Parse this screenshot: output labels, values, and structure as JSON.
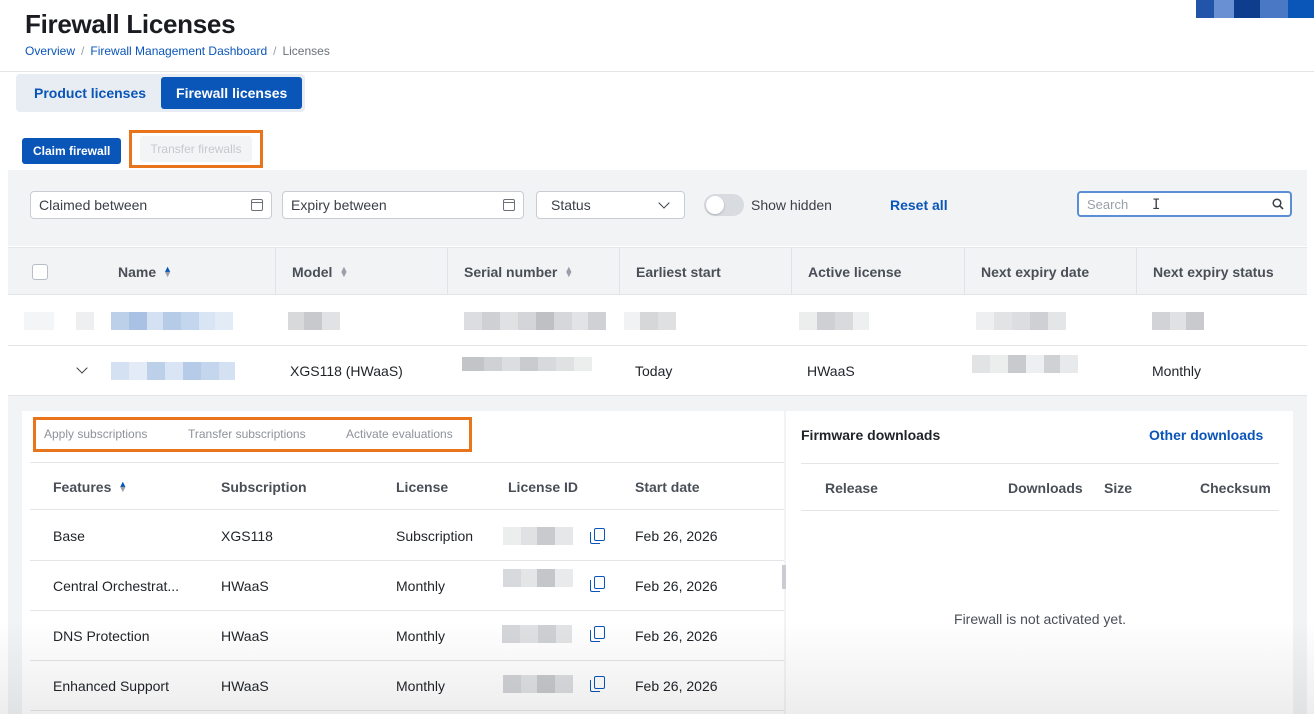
{
  "header": {
    "title": "Firewall Licenses",
    "breadcrumb": [
      "Overview",
      "Firewall Management Dashboard",
      "Licenses"
    ],
    "logo_colors": [
      "#2255aa",
      "#0e3d8e",
      "#4b78c4",
      "#0a55b8",
      "#6a90d4"
    ]
  },
  "tabs": [
    {
      "label": "Product licenses",
      "active": false
    },
    {
      "label": "Firewall licenses",
      "active": true
    }
  ],
  "actions": {
    "claim": "Claim firewall",
    "transfer": "Transfer firewalls"
  },
  "filters": {
    "claimed": "Claimed between",
    "expiry": "Expiry between",
    "status": "Status",
    "show_hidden": "Show hidden",
    "reset": "Reset all",
    "search_placeholder": "Search"
  },
  "table": {
    "columns": [
      "Name",
      "Model",
      "Serial number",
      "Earliest start",
      "Active license",
      "Next expiry date",
      "Next expiry status"
    ],
    "rows": [
      {
        "model": "",
        "earliest_start": "",
        "active_license": "",
        "next_expiry_status": ""
      },
      {
        "model": "XGS118 (HWaaS)",
        "earliest_start": "Today",
        "active_license": "HWaaS",
        "next_expiry_status": "Monthly"
      }
    ]
  },
  "subscriptions": {
    "actions": [
      "Apply subscriptions",
      "Transfer subscriptions",
      "Activate evaluations"
    ],
    "columns": [
      "Features",
      "Subscription",
      "License",
      "License ID",
      "Start date"
    ],
    "rows": [
      {
        "feature": "Base",
        "subscription": "XGS118",
        "license": "Subscription",
        "start": "Feb 26, 2026"
      },
      {
        "feature": "Central Orchestrat...",
        "subscription": "HWaaS",
        "license": "Monthly",
        "start": "Feb 26, 2026"
      },
      {
        "feature": "DNS Protection",
        "subscription": "HWaaS",
        "license": "Monthly",
        "start": "Feb 26, 2026"
      },
      {
        "feature": "Enhanced Support",
        "subscription": "HWaaS",
        "license": "Monthly",
        "start": "Feb 26, 2026"
      }
    ]
  },
  "firmware": {
    "title": "Firmware downloads",
    "other_link": "Other downloads",
    "columns": [
      "Release",
      "Downloads",
      "Size",
      "Checksum"
    ],
    "empty_message": "Firewall is not activated yet."
  }
}
